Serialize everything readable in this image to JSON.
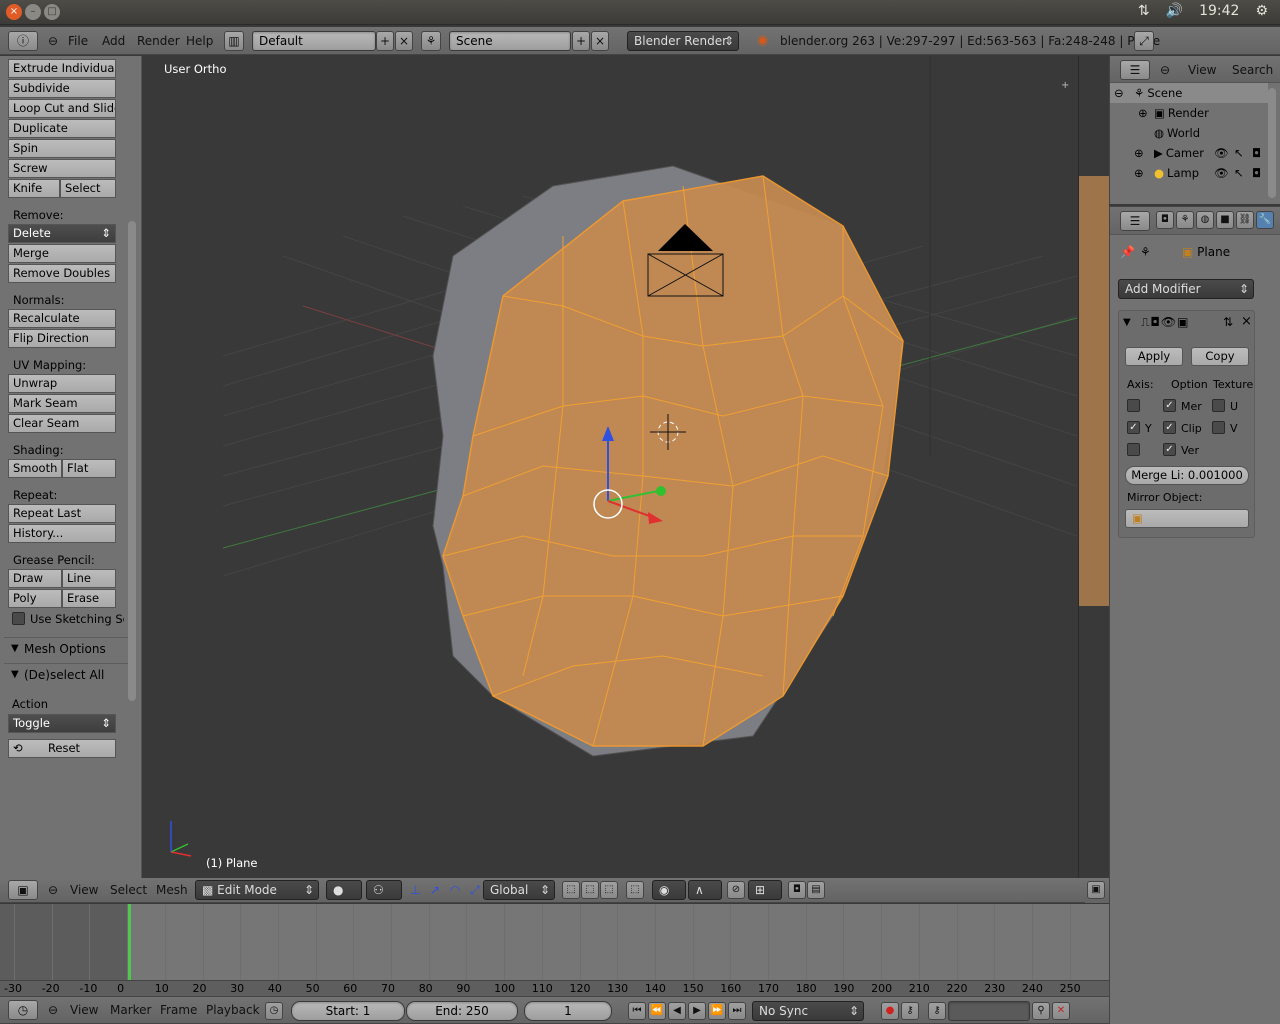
{
  "os": {
    "time": "19:42",
    "close": "×",
    "min": "–",
    "max": "□"
  },
  "top_header": {
    "menus": [
      "File",
      "Add",
      "Render",
      "Help"
    ],
    "layout": "Default",
    "scene": "Scene",
    "engine": "Blender Render",
    "info": "blender.org 263 | Ve:297-297 | Ed:563-563 | Fa:248-248 | Plane"
  },
  "toolshelf": {
    "add_tools": [
      "Extrude Individual",
      "Subdivide",
      "Loop Cut and Slide",
      "Duplicate",
      "Spin",
      "Screw"
    ],
    "knife": "Knife",
    "select": "Select",
    "remove_label": "Remove:",
    "delete": "Delete",
    "merge": "Merge",
    "remove_doubles": "Remove Doubles",
    "normals_label": "Normals:",
    "recalculate": "Recalculate",
    "flip_direction": "Flip Direction",
    "uv_label": "UV Mapping:",
    "unwrap": "Unwrap",
    "mark_seam": "Mark Seam",
    "clear_seam": "Clear Seam",
    "shading_label": "Shading:",
    "smooth": "Smooth",
    "flat": "Flat",
    "repeat_label": "Repeat:",
    "repeat_last": "Repeat Last",
    "history": "History...",
    "grease_label": "Grease Pencil:",
    "draw": "Draw",
    "line": "Line",
    "poly": "Poly",
    "erase": "Erase",
    "use_sketching": "Use Sketching Se",
    "mesh_options": "Mesh Options",
    "deselect_all": "(De)select All",
    "action_label": "Action",
    "action_value": "Toggle",
    "reset": "Reset"
  },
  "viewport": {
    "title": "User Ortho",
    "object": "(1) Plane"
  },
  "outliner": {
    "view": "View",
    "search": "Search",
    "items": [
      "Scene",
      "Render",
      "World",
      "Camer",
      "Lamp"
    ]
  },
  "properties": {
    "object": "Plane",
    "add_modifier": "Add Modifier",
    "apply": "Apply",
    "copy": "Copy",
    "axis_label": "Axis:",
    "option_label": "Option",
    "texture_label": "Texture",
    "mer": "Mer",
    "u": "U",
    "y": "Y",
    "clip": "Clip",
    "v": "V",
    "ver": "Ver",
    "merge_limit": "Merge Li: 0.001000",
    "mirror_object": "Mirror Object:"
  },
  "viewport_header": {
    "menus": [
      "View",
      "Select",
      "Mesh"
    ],
    "mode": "Edit Mode",
    "orientation": "Global"
  },
  "timeline": {
    "ticks": [
      "-30",
      "-20",
      "-10",
      "0",
      "10",
      "20",
      "30",
      "40",
      "50",
      "60",
      "70",
      "80",
      "90",
      "100",
      "110",
      "120",
      "130",
      "140",
      "150",
      "160",
      "170",
      "180",
      "190",
      "200",
      "210",
      "220",
      "230",
      "240",
      "250"
    ],
    "menus": [
      "View",
      "Marker",
      "Frame",
      "Playback"
    ],
    "start": "Start: 1",
    "end": "End: 250",
    "current": "1",
    "sync": "No Sync"
  },
  "colors": {
    "accent": "#f0a030",
    "selected_face": "#d9924a",
    "cursor": "#50c850"
  }
}
